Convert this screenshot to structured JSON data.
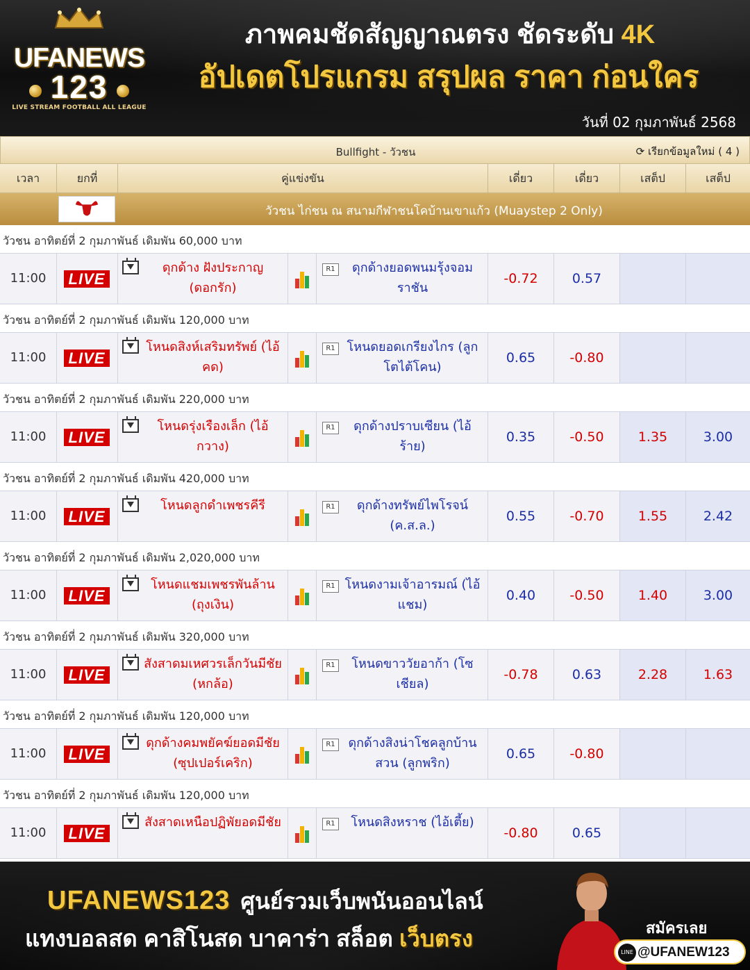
{
  "header": {
    "brand": "UFANEWS",
    "brand_num": "123",
    "brand_tagline": "LIVE STREAM FOOTBALL ALL LEAGUE",
    "title_line1": "ภาพคมชัดสัญญาณตรง ชัดระดับ",
    "title_line1_highlight": "4K",
    "title_line2": "อัปเดตโปรแกรม สรุปผล ราคา ก่อนใคร",
    "date": "วันที่  02 กุมภาพันธ์ 2568"
  },
  "table": {
    "league_title": "Bullfight - วัวชน",
    "refresh": "เรียกข้อมูลใหม่ ( 4 )",
    "columns": [
      "เวลา",
      "ยกที่",
      "คู่แข่งขัน",
      "เดี่ยว",
      "เดี่ยว",
      "เสต็ป",
      "เสต็ป"
    ],
    "league_name": "วัวชน ไก่ชน ณ สนามกีฬาชนโคบ้านเขาแก้ว (Muaystep 2 Only)",
    "live_label": "LIVE",
    "round_label": "R1",
    "matches": [
      {
        "event": "วัวชน อาทิตย์ที่ 2 กุมภาพันธ์ เดิมพัน 60,000 บาท",
        "time": "11:00",
        "home": "ดุกด้าง ฝังประกาญ (ดอกรัก)",
        "away": "ดุกด้างยอดพนมรุ้งจอมราชัน",
        "o1": "-0.72",
        "o2": "0.57",
        "o3": "",
        "o4": ""
      },
      {
        "event": "วัวชน อาทิตย์ที่ 2 กุมภาพันธ์ เดิมพัน 120,000 บาท",
        "time": "11:00",
        "home": "โหนดสิงห์เสริมทรัพย์ (ไอ้คด)",
        "away": "โหนดยอดเกรียงไกร (ลูกโตไต้โคน)",
        "o1": "0.65",
        "o2": "-0.80",
        "o3": "",
        "o4": ""
      },
      {
        "event": "วัวชน อาทิตย์ที่ 2 กุมภาพันธ์ เดิมพัน 220,000 บาท",
        "time": "11:00",
        "home": "โหนดรุ่งเรืองเล็ก (ไอ้กวาง)",
        "away": "ดุกด้างปราบเซียน (ไอ้ร้าย)",
        "o1": "0.35",
        "o2": "-0.50",
        "o3": "1.35",
        "o4": "3.00"
      },
      {
        "event": "วัวชน อาทิตย์ที่ 2 กุมภาพันธ์ เดิมพัน 420,000 บาท",
        "time": "11:00",
        "home": "โหนดลูกดำเพชรคีรี",
        "away": "ดุกด้างทรัพย์ไพโรจน์ (ค.ส.ล.)",
        "o1": "0.55",
        "o2": "-0.70",
        "o3": "1.55",
        "o4": "2.42"
      },
      {
        "event": "วัวชน อาทิตย์ที่ 2 กุมภาพันธ์ เดิมพัน 2,020,000 บาท",
        "time": "11:00",
        "home": "โหนดแชมเพชรพันล้าน (ถุงเงิน)",
        "away": "โหนดงามเจ้าอารมณ์ (ไอ้แชม)",
        "o1": "0.40",
        "o2": "-0.50",
        "o3": "1.40",
        "o4": "3.00"
      },
      {
        "event": "วัวชน อาทิตย์ที่ 2 กุมภาพันธ์ เดิมพัน 320,000 บาท",
        "time": "11:00",
        "home": "สังสาดมเหศวรเล็กวันมีชัย (หกล้อ)",
        "away": "โหนดขาววัยอาก้า (โซเชียล)",
        "o1": "-0.78",
        "o2": "0.63",
        "o3": "2.28",
        "o4": "1.63"
      },
      {
        "event": "วัวชน อาทิตย์ที่ 2 กุมภาพันธ์ เดิมพัน 120,000 บาท",
        "time": "11:00",
        "home": "ดุกด้างคมพยัคฆ์ยอดมีชัย (ซุปเปอร์เคริก)",
        "away": "ดุกด้างสิงน่าโชคลูกบ้านสวน (ลูกพริก)",
        "o1": "0.65",
        "o2": "-0.80",
        "o3": "",
        "o4": ""
      },
      {
        "event": "วัวชน อาทิตย์ที่ 2 กุมภาพันธ์ เดิมพัน 120,000 บาท",
        "time": "11:00",
        "home": "สังสาดเหนือปฏิพัยอดมีชัย",
        "away": "โหนดสิงหราช (ไอ้เตี้ย)",
        "o1": "-0.80",
        "o2": "0.65",
        "o3": "",
        "o4": ""
      }
    ]
  },
  "footer": {
    "brand": "UFANEWS123",
    "tagline1": "ศูนย์รวมเว็บพนันออนไลน์",
    "tagline2": "แทงบอลสด คาสิโนสด บาคาร่า สล็อต",
    "tagline2_highlight": "เว็บตรง",
    "signup": "สมัครเลย",
    "line_label": "LINE",
    "line_id": "@UFANEW123"
  },
  "colors": {
    "gold": "#f3c740",
    "red": "#d40000",
    "blue": "#1c2ea5"
  }
}
